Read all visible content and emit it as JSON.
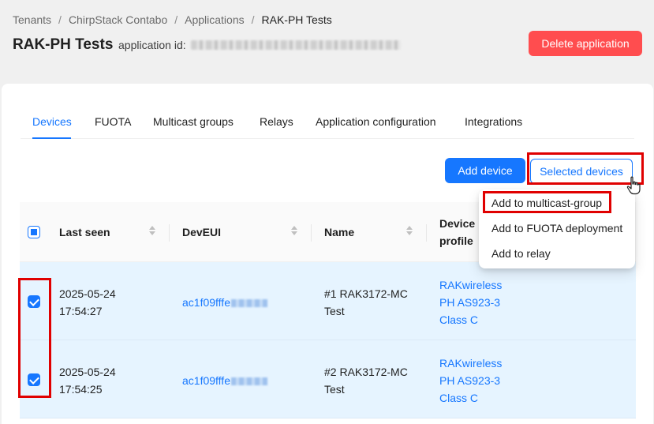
{
  "breadcrumb": {
    "items": [
      "Tenants",
      "ChirpStack Contabo",
      "Applications",
      "RAK-PH Tests"
    ],
    "separator": "/"
  },
  "header": {
    "title": "RAK-PH Tests",
    "app_id_label": "application id:",
    "delete_label": "Delete application"
  },
  "tabs": [
    {
      "label": "Devices",
      "active": true
    },
    {
      "label": "FUOTA"
    },
    {
      "label": "Multicast groups"
    },
    {
      "label": "Relays"
    },
    {
      "label": "Application configuration"
    },
    {
      "label": "Integrations"
    }
  ],
  "actions": {
    "add_device": "Add device",
    "selected_devices": "Selected devices"
  },
  "dropdown": {
    "items": [
      "Add to multicast-group",
      "Add to FUOTA deployment",
      "Add to relay"
    ]
  },
  "table": {
    "columns": [
      "Last seen",
      "DevEUI",
      "Name",
      "Device",
      "profile"
    ],
    "rows": [
      {
        "last_seen_date": "2025-05-24",
        "last_seen_time": "17:54:27",
        "deveui": "ac1f09fffe",
        "name_line1": "#1 RAK3172-MC",
        "name_line2": "Test",
        "profile": [
          "RAKwireless",
          "PH AS923-3",
          "Class C"
        ],
        "checked": true
      },
      {
        "last_seen_date": "2025-05-24",
        "last_seen_time": "17:54:25",
        "deveui": "ac1f09fffe",
        "name_line1": "#2 RAK3172-MC",
        "name_line2": "Test",
        "profile": [
          "RAKwireless",
          "PH AS923-3",
          "Class C"
        ],
        "checked": true
      }
    ]
  },
  "colors": {
    "primary": "#1677ff",
    "danger": "#ff4d4f",
    "highlight": "#e00000",
    "row_selected": "#e6f4ff"
  }
}
